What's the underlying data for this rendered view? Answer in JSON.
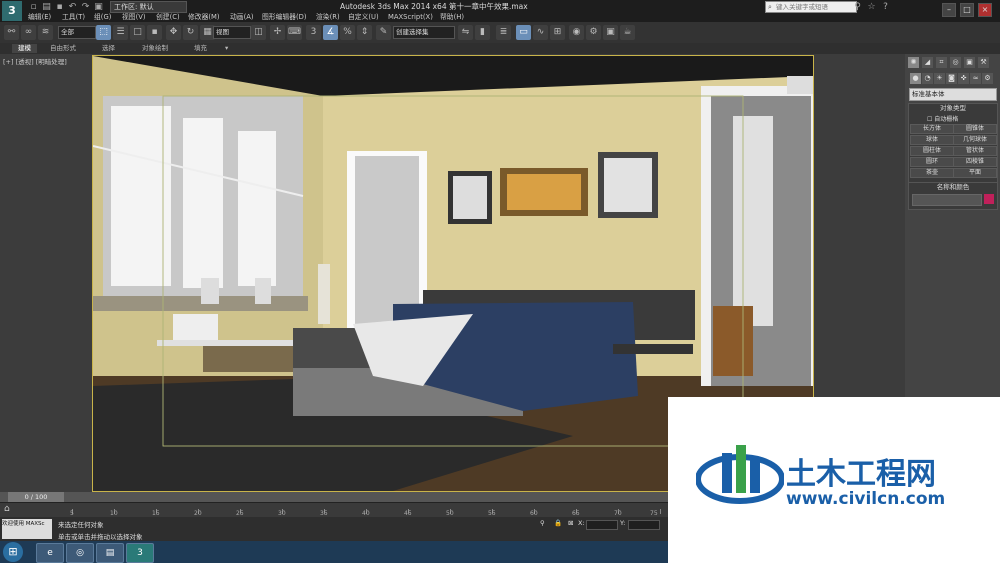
{
  "titlebar": {
    "logo_text": "3",
    "workspace": "工作区: 默认",
    "app_title": "Autodesk 3ds Max  2014 x64     第十一章中午效果.max",
    "search_placeholder": "键入关键字或短语"
  },
  "menu": [
    "编辑(E)",
    "工具(T)",
    "组(G)",
    "视图(V)",
    "创建(C)",
    "修改器(M)",
    "动画(A)",
    "图形编辑器(D)",
    "渲染(R)",
    "自定义(U)",
    "MAXScript(X)",
    "帮助(H)"
  ],
  "toolbar": {
    "selection_filter": "全部",
    "ref_coord": "视图",
    "named_sel": "创建选择集"
  },
  "ribbon_tabs": [
    "建模",
    "自由形式",
    "选择",
    "对象绘制",
    "填充"
  ],
  "viewport": {
    "label": "[+] [透视] [明暗处理]"
  },
  "command_panel": {
    "category": "标准基本体",
    "object_type_title": "对象类型",
    "auto_grid": "自动栅格",
    "buttons": [
      "长方体",
      "圆锥体",
      "球体",
      "几何球体",
      "圆柱体",
      "管状体",
      "圆环",
      "四棱锥",
      "茶壶",
      "平面"
    ],
    "name_color_title": "名称和颜色",
    "name_color_swatch": "#c0205a"
  },
  "timeline": {
    "frame": "0 / 100",
    "ticks": [
      "5",
      "10",
      "15",
      "20",
      "25",
      "30",
      "35",
      "40",
      "45",
      "50",
      "55",
      "60",
      "65",
      "70",
      "75"
    ]
  },
  "status": {
    "left_top": "来选定任何对象",
    "left_bottom": "单击或单击并拖动以选择对象",
    "maxscript": "欢迎使用 MAXSc",
    "x_label": "X:",
    "y_label": "Y:"
  },
  "watermark": {
    "title": "土木工程网",
    "url": "www.civilcn.com",
    "accent": "#1a5fa8",
    "accent2": "#3aa14a"
  }
}
